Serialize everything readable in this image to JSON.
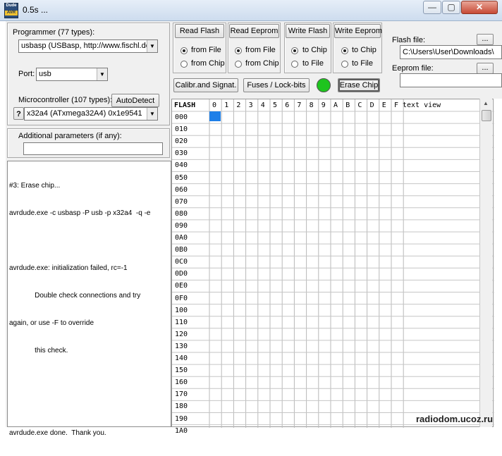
{
  "window": {
    "title": "0.5s ...",
    "icon_top": "Dude",
    "icon_bottom": "AVR",
    "minimize": "—",
    "maximize": "▢",
    "close": "✕"
  },
  "programmer": {
    "label": "Programmer (77 types):",
    "value": "usbasp (USBasp, http://www.fischl.de",
    "port_label": "Port:",
    "port_value": "usb"
  },
  "microcontroller": {
    "label": "Microcontroller (107 types):",
    "autodetect": "AutoDetect",
    "help": "?",
    "value": "x32a4 (ATxmega32A4) 0x1e9541"
  },
  "additional": {
    "label": "Additional parameters (if any):",
    "value": ""
  },
  "log": [
    "#3: Erase chip...",
    "avrdude.exe -c usbasp -P usb -p x32a4  -q -e",
    "",
    "avrdude.exe: initialization failed, rc=-1",
    "             Double check connections and try",
    "again, or use -F to override",
    "             this check.",
    "",
    "",
    "avrdude.exe done.  Thank you."
  ],
  "actions": {
    "read_flash": "Read Flash",
    "read_eeprom": "Read Eeprom",
    "write_flash": "Write Flash",
    "write_eeprom": "Write Eeprom",
    "calib": "Calibr.and Signat.",
    "fuses": "Fuses / Lock-bits",
    "erase": "Erase Chip",
    "status_color": "#1ec41e"
  },
  "radios": {
    "read_flash": [
      "from File",
      "from Chip"
    ],
    "read_eeprom": [
      "from File",
      "from Chip"
    ],
    "write_flash": [
      "to Chip",
      "to File"
    ],
    "write_eeprom": [
      "to Chip",
      "to File"
    ]
  },
  "files": {
    "flash_label": "Flash file:",
    "flash_value": "C:\\Users\\User\\Downloads\\",
    "eeprom_label": "Eeprom file:",
    "eeprom_value": "",
    "browse": "..."
  },
  "hex": {
    "corner": "FLASH",
    "columns": [
      "0",
      "1",
      "2",
      "3",
      "4",
      "5",
      "6",
      "7",
      "8",
      "9",
      "A",
      "B",
      "C",
      "D",
      "E",
      "F"
    ],
    "text_view": "text view",
    "rows": [
      "000",
      "010",
      "020",
      "030",
      "040",
      "050",
      "060",
      "070",
      "080",
      "090",
      "0A0",
      "0B0",
      "0C0",
      "0D0",
      "0E0",
      "0F0",
      "100",
      "110",
      "120",
      "130",
      "140",
      "150",
      "160",
      "170",
      "180",
      "190",
      "1A0"
    ],
    "selected_color": "#1e7fe8"
  },
  "watermark": "radiodom.ucoz.ru"
}
